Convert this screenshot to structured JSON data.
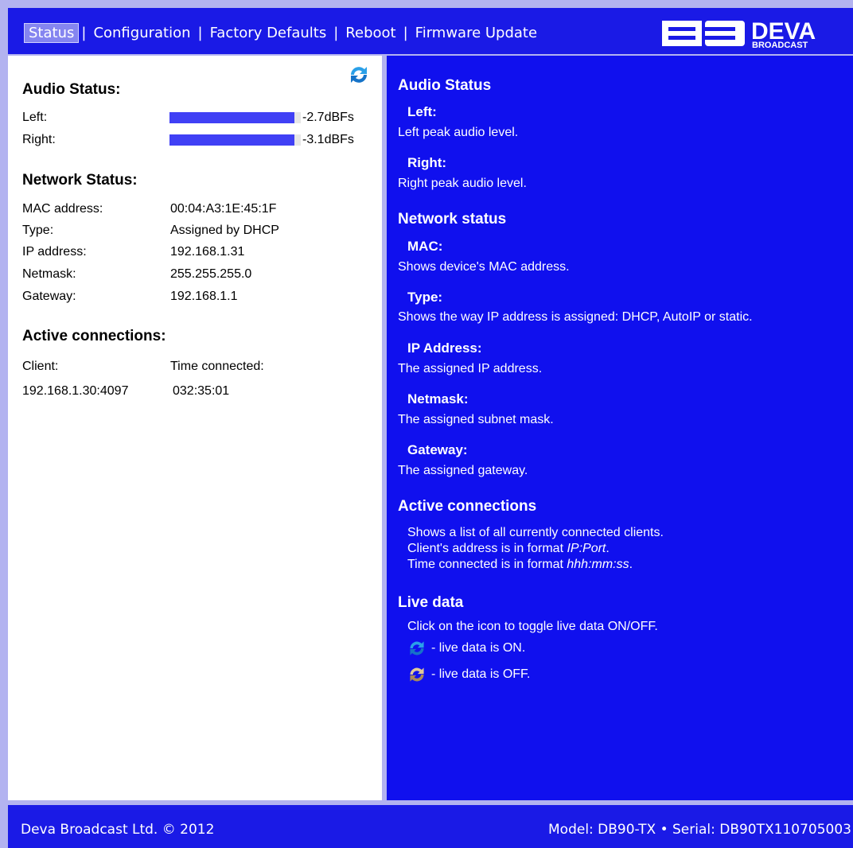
{
  "nav": {
    "items": [
      "Status",
      "Configuration",
      "Factory Defaults",
      "Reboot",
      "Firmware Update"
    ],
    "separator": "|",
    "active": "Status"
  },
  "logo": {
    "brand": "DEVA",
    "sub": "BROADCAST",
    "mark": "DB"
  },
  "left": {
    "audio": {
      "title": "Audio Status:",
      "left_label": "Left:",
      "right_label": "Right:",
      "left_value": "-2.7dBFs",
      "right_value": "-3.1dBFs",
      "left_level": 0.95,
      "right_level": 0.95
    },
    "network": {
      "title": "Network Status:",
      "mac_label": "MAC address:",
      "mac_value": "00:04:A3:1E:45:1F",
      "type_label": "Type:",
      "type_value": "Assigned by DHCP",
      "ip_label": "IP address:",
      "ip_value": "192.168.1.31",
      "netmask_label": "Netmask:",
      "netmask_value": "255.255.255.0",
      "gateway_label": "Gateway:",
      "gateway_value": "192.168.1.1"
    },
    "connections": {
      "title": "Active connections:",
      "client_header": "Client:",
      "time_header": "Time connected:",
      "rows": [
        {
          "client": "192.168.1.30:4097",
          "time": "032:35:01"
        }
      ]
    }
  },
  "help": {
    "audio_title": "Audio Status",
    "left_title": "Left:",
    "left_desc": "Left peak audio level.",
    "right_title": "Right:",
    "right_desc": "Right peak audio level.",
    "network_title": "Network status",
    "mac_title": "MAC:",
    "mac_desc": "Shows device's MAC address.",
    "type_title": "Type:",
    "type_desc": "Shows the way IP address is assigned: DHCP, AutoIP or static.",
    "ip_title": "IP Address:",
    "ip_desc": "The assigned IP address.",
    "netmask_title": "Netmask:",
    "netmask_desc": "The assigned subnet mask.",
    "gateway_title": "Gateway:",
    "gateway_desc": "The assigned gateway.",
    "connections_title": "Active connections",
    "conn_line1": "Shows a list of all currently connected clients.",
    "conn_line2_prefix": "Client's address is in format ",
    "conn_line2_em": "IP:Port",
    "conn_line2_suffix": ".",
    "conn_line3_prefix": "Time connected is in format ",
    "conn_line3_em": "hhh:mm:ss",
    "conn_line3_suffix": ".",
    "live_title": "Live data",
    "live_desc": "Click on the icon to toggle live data ON/OFF.",
    "live_on": "- live data is ON.",
    "live_off": "- live data is OFF."
  },
  "footer": {
    "copyright": "Deva Broadcast Ltd. © 2012",
    "model_info": "Model: DB90-TX • Serial: DB90TX110705003"
  },
  "colors": {
    "header_bg": "#1a1ae6",
    "help_bg": "#1010ee",
    "bar": "#4040f5",
    "icon_on": "#2aa0e8",
    "icon_off": "#c9a870"
  }
}
